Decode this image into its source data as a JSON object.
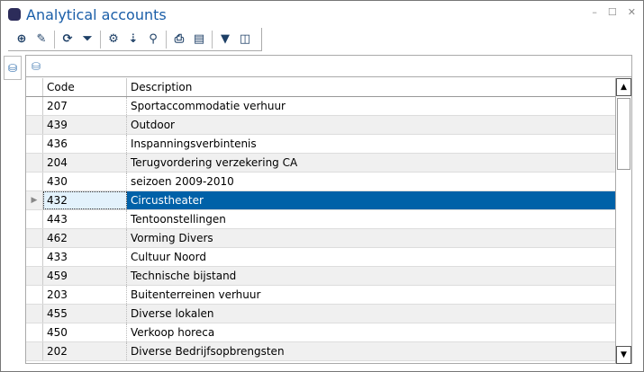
{
  "window": {
    "title": "Analytical accounts",
    "minimize": "–",
    "maximize": "☐",
    "close": "✕"
  },
  "toolbar": [
    {
      "name": "add",
      "glyph": "⊕"
    },
    {
      "name": "edit",
      "glyph": "✎"
    },
    {
      "name": "refresh",
      "glyph": "⟳"
    },
    {
      "name": "clear-filter",
      "glyph": "⏷"
    },
    {
      "name": "settings",
      "glyph": "⚙"
    },
    {
      "name": "sort-az",
      "glyph": "⇣"
    },
    {
      "name": "search",
      "glyph": "⚲"
    },
    {
      "name": "print",
      "glyph": "⎙"
    },
    {
      "name": "export-csv",
      "glyph": "▤"
    },
    {
      "name": "filter",
      "glyph": "▼"
    },
    {
      "name": "columns",
      "glyph": "◫"
    }
  ],
  "grid": {
    "columns": [
      "Code",
      "Description"
    ],
    "selected_index": 5,
    "rows": [
      [
        "207",
        "Sportaccommodatie verhuur"
      ],
      [
        "439",
        "Outdoor"
      ],
      [
        "436",
        "Inspanningsverbintenis"
      ],
      [
        "204",
        "Terugvordering verzekering CA"
      ],
      [
        "430",
        "seizoen 2009-2010"
      ],
      [
        "432",
        "Circustheater"
      ],
      [
        "443",
        "Tentoonstellingen"
      ],
      [
        "462",
        "Vorming Divers"
      ],
      [
        "433",
        "Cultuur Noord"
      ],
      [
        "459",
        "Technische bijstand"
      ],
      [
        "203",
        "Buitenterreinen verhuur"
      ],
      [
        "455",
        "Diverse lokalen"
      ],
      [
        "450",
        "Verkoop horeca"
      ],
      [
        "202",
        "Diverse Bedrijfsopbrengsten"
      ]
    ]
  }
}
